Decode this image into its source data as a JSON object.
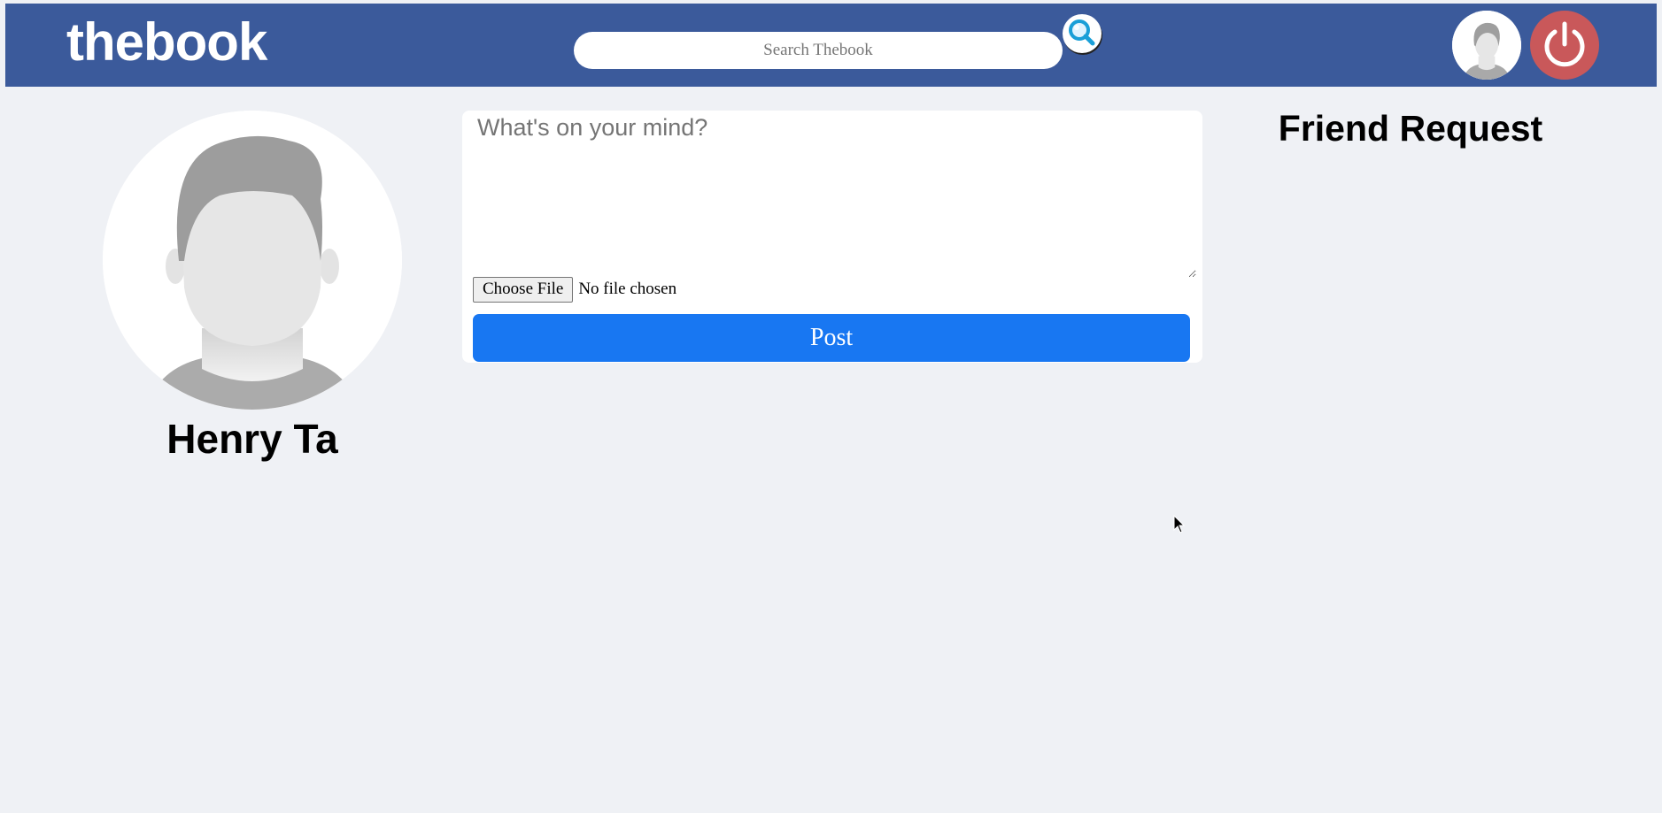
{
  "header": {
    "logo": "thebook",
    "search": {
      "placeholder": "Search Thebook",
      "value": ""
    },
    "icons": {
      "search_button": "search-icon",
      "profile_avatar": "user-avatar-icon",
      "logout_button": "power-icon"
    },
    "colors": {
      "bar": "#3b5a9b",
      "logout": "#c9585a"
    }
  },
  "profile": {
    "name": "Henry Ta",
    "avatar": "default-user-avatar"
  },
  "composer": {
    "placeholder": "What's on your mind?",
    "value": "",
    "choose_file_label": "Choose File",
    "file_status": "No file chosen",
    "post_label": "Post",
    "colors": {
      "post_button": "#1877f2"
    }
  },
  "friend_requests": {
    "heading": "Friend Request",
    "items": []
  },
  "theme": {
    "page_background": "#eff1f5"
  }
}
